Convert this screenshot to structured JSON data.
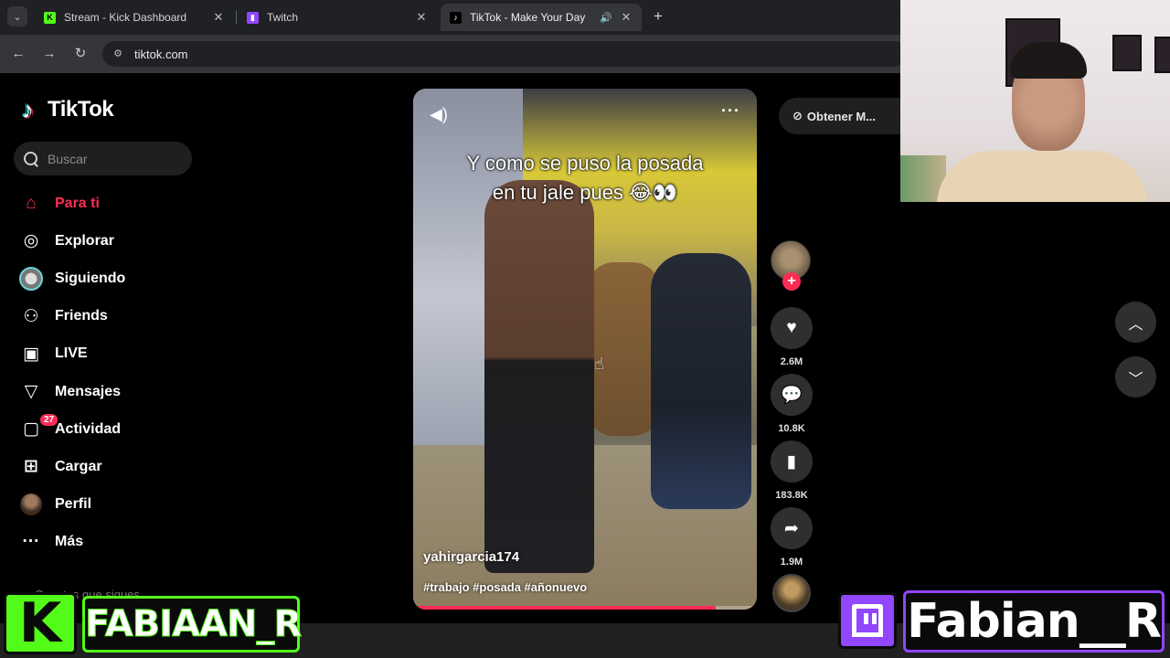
{
  "browser": {
    "tabs": [
      {
        "title": "Stream - Kick Dashboard",
        "favicon": "kick-icon",
        "active": false
      },
      {
        "title": "Twitch",
        "favicon": "twitch-icon",
        "active": false
      },
      {
        "title": "TikTok - Make Your Day",
        "favicon": "tiktok-icon",
        "active": true,
        "audio": true
      }
    ],
    "url": "tiktok.com",
    "close_glyph": "✕",
    "newtab_glyph": "+"
  },
  "tiktok": {
    "logo_text": "TikTok",
    "search_placeholder": "Buscar",
    "nav": [
      {
        "label": "Para ti",
        "icon": "home-icon",
        "active": true
      },
      {
        "label": "Explorar",
        "icon": "compass-icon"
      },
      {
        "label": "Siguiendo",
        "icon": "following-avatar-icon"
      },
      {
        "label": "Friends",
        "icon": "friends-icon"
      },
      {
        "label": "LIVE",
        "icon": "live-tv-icon"
      },
      {
        "label": "Mensajes",
        "icon": "send-icon"
      },
      {
        "label": "Actividad",
        "icon": "inbox-icon",
        "badge": "27"
      },
      {
        "label": "Cargar",
        "icon": "upload-plus-icon"
      },
      {
        "label": "Perfil",
        "icon": "profile-avatar-icon"
      },
      {
        "label": "Más",
        "icon": "more-dots-icon"
      }
    ],
    "sidebar_footer": "Cuentas que sigues",
    "get_app_label": "Obtener M..."
  },
  "video": {
    "caption_line1": "Y como se puso la posada",
    "caption_line2": "en tu jale pues 😂👀",
    "author": "yahirgarcia174",
    "tags": "#trabajo #posada #añonuevo",
    "progress": 0.88,
    "accent": "#fe2c55"
  },
  "actions": {
    "likes": "2.6M",
    "comments": "10.8K",
    "saves": "183.8K",
    "shares": "1.9M"
  },
  "overlays": {
    "kick_name": "FABIAAN_R",
    "twitch_name": "Fabian__R",
    "kick_color": "#53fc18",
    "twitch_color": "#9146ff"
  }
}
